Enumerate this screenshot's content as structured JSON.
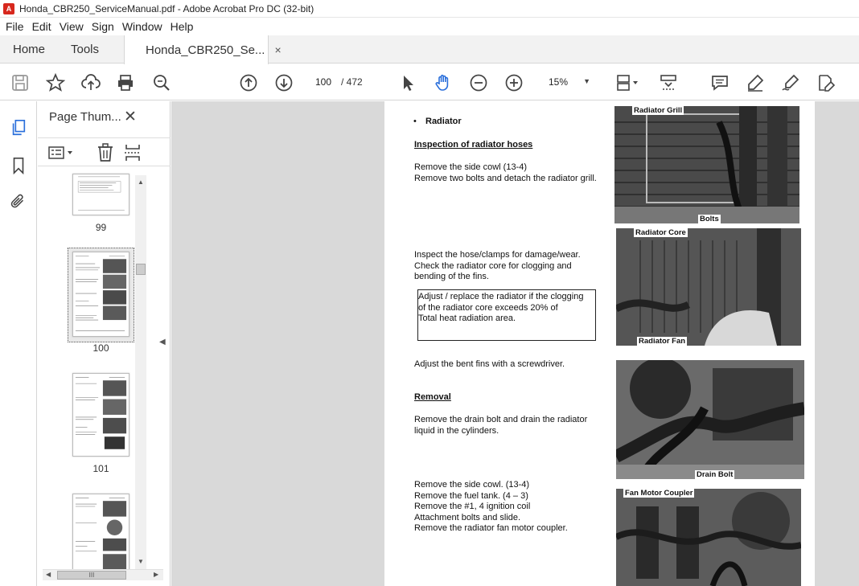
{
  "window": {
    "title": "Honda_CBR250_ServiceManual.pdf - Adobe Acrobat Pro DC (32-bit)",
    "app_icon_glyph": "A"
  },
  "menu": [
    "File",
    "Edit",
    "View",
    "Sign",
    "Window",
    "Help"
  ],
  "tabs": {
    "home": "Home",
    "tools": "Tools",
    "doc": "Honda_CBR250_Se...",
    "close_glyph": "×"
  },
  "toolbar": {
    "page_current": "100",
    "page_total": "/  472",
    "zoom": "15%"
  },
  "panel": {
    "title": "Page Thum...",
    "close_glyph": "✕",
    "thumbnails": [
      {
        "label": "99"
      },
      {
        "label": "100"
      },
      {
        "label": "101"
      },
      {
        "label": ""
      }
    ],
    "hscroll_glyph": "III"
  },
  "document": {
    "bullet": "•",
    "heading": "Radiator",
    "section1": "Inspection of radiator hoses",
    "p1": "Remove the side cowl  (13-4)\nRemove two bolts and detach the radiator grill.",
    "p2": "Inspect the hose/clamps for damage/wear.\nCheck the radiator core for clogging and\nbending of the fins.",
    "note": "Adjust / replace the radiator if the clogging\nof the radiator core exceeds 20% of\nTotal  heat radiation area.",
    "p3": "Adjust the bent fins with a screwdriver.",
    "section2": "Removal",
    "p4": "Remove the drain bolt and drain the radiator\nliquid in the cylinders.",
    "p5": "Remove the side cowl.  (13-4)\nRemove the fuel tank.  (4 – 3)\nRemove the #1, 4 ignition coil\nAttachment bolts and slide.\nRemove the radiator fan motor coupler.",
    "captions": {
      "grill": "Radiator Grill",
      "bolts": "Bolts",
      "core": "Radiator Core",
      "fan": "Radiator Fan",
      "drain": "Drain Bolt",
      "coupler": "Fan Motor Coupler"
    }
  },
  "icons": [
    "save-icon",
    "bookmark-star-icon",
    "upload-icon",
    "print-icon",
    "zoom-search-icon",
    "page-up-icon",
    "page-down-icon",
    "select-cursor-icon",
    "hand-tool-icon",
    "zoom-out-icon",
    "zoom-in-icon",
    "page-display-icon",
    "scroll-mode-icon",
    "comment-icon",
    "highlight-icon",
    "sign-icon",
    "edit-pdf-icon",
    "thumbnails-icon",
    "bookmarks-icon",
    "attachments-icon"
  ],
  "colors": {
    "accent": "#2a6fdb",
    "titlebar_icon": "#d7281d",
    "doc_bg": "#d9d9d9"
  }
}
